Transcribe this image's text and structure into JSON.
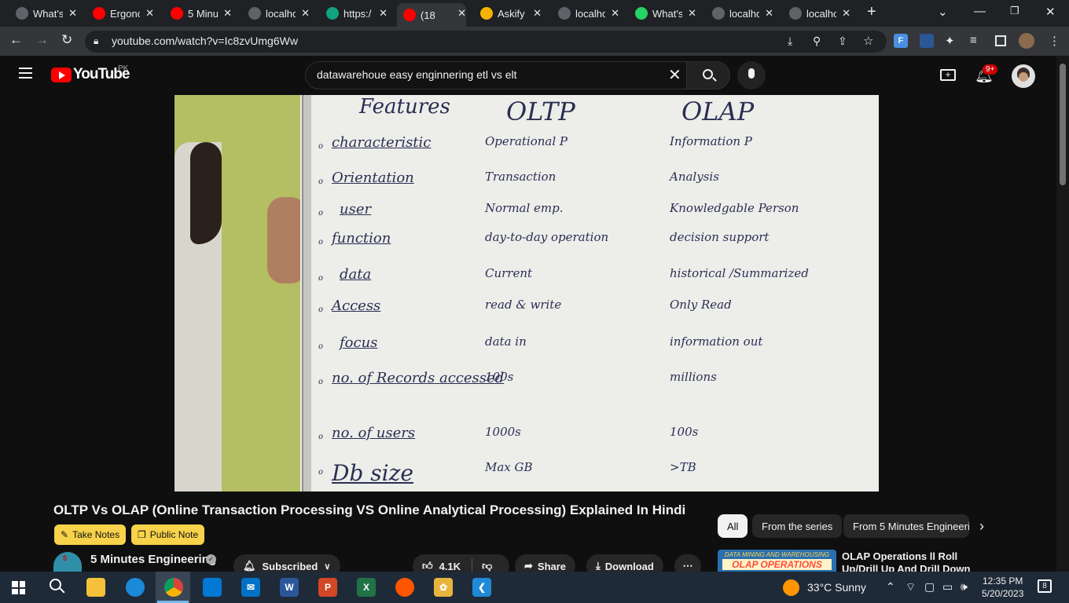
{
  "tabs": [
    {
      "label": "What's",
      "color": "#5f6368",
      "icon": "chrome-icon"
    },
    {
      "label": "Ergono",
      "color": "#ff0000",
      "icon": "youtube-icon"
    },
    {
      "label": "5 Minu",
      "color": "#ff0000",
      "icon": "youtube-icon"
    },
    {
      "label": "localho",
      "color": "#5f6368",
      "icon": "localhost-icon"
    },
    {
      "label": "https:/",
      "color": "#10a37f",
      "icon": "openai-icon"
    },
    {
      "label": "(18",
      "color": "#ff0000",
      "icon": "youtube-icon"
    },
    {
      "label": "Askify",
      "color": "#f4b400",
      "icon": "askify-icon"
    },
    {
      "label": "localho",
      "color": "#5f6368",
      "icon": "globe-icon"
    },
    {
      "label": "What's",
      "color": "#25d366",
      "icon": "whatsapp-icon"
    },
    {
      "label": "localho",
      "color": "#5f6368",
      "icon": "localhost-icon"
    },
    {
      "label": "localho",
      "color": "#5f6368",
      "icon": "globe-icon"
    }
  ],
  "browser": {
    "url": "youtube.com/watch?v=Ic8zvUmg6Ww"
  },
  "youtube": {
    "logo": "YouTube",
    "region": "PK",
    "search_value": "datawarehoue  easy enginnering etl vs elt",
    "notifications": "9+"
  },
  "whiteboard": {
    "headers": [
      "Features",
      "OLTP",
      "OLAP"
    ],
    "rows": [
      [
        "characteristic",
        "Operational P",
        "Information P"
      ],
      [
        "Orientation",
        "Transaction",
        "Analysis"
      ],
      [
        "user",
        "Normal emp.",
        "Knowledgable Person"
      ],
      [
        "function",
        "day-to-day operation",
        "decision support"
      ],
      [
        "data",
        "Current",
        "historical /Summarized"
      ],
      [
        "Access",
        "read & write",
        "Only Read"
      ],
      [
        "focus",
        "data in",
        "information out"
      ],
      [
        "no. of Records accessed",
        "100s",
        "millions"
      ],
      [
        "no. of users",
        "1000s",
        "100s"
      ],
      [
        "Db size",
        "Max GB",
        ">TB"
      ]
    ]
  },
  "video": {
    "title": "OLTP Vs OLAP (Online Transaction Processing VS Online Analytical Processing) Explained In Hindi",
    "channel": "5 Minutes Engineering",
    "subscribed": "Subscribed",
    "likes": "4.1K",
    "share": "Share",
    "download": "Download",
    "take_notes": "Take Notes",
    "public_note": "Public Note"
  },
  "chips": [
    "All",
    "From the series",
    "From 5 Minutes Engineeri"
  ],
  "recommended": {
    "thumb_top": "DATA MINING AND WAREHOUSING",
    "thumb_main": "OLAP OPERATIONS",
    "title": "OLAP Operations ll Roll Up/Drill Up And Drill Down Explained In"
  },
  "taskbar": {
    "weather": "33°C  Sunny",
    "time": "12:35 PM",
    "date": "5/20/2023",
    "notif_count": "8"
  }
}
